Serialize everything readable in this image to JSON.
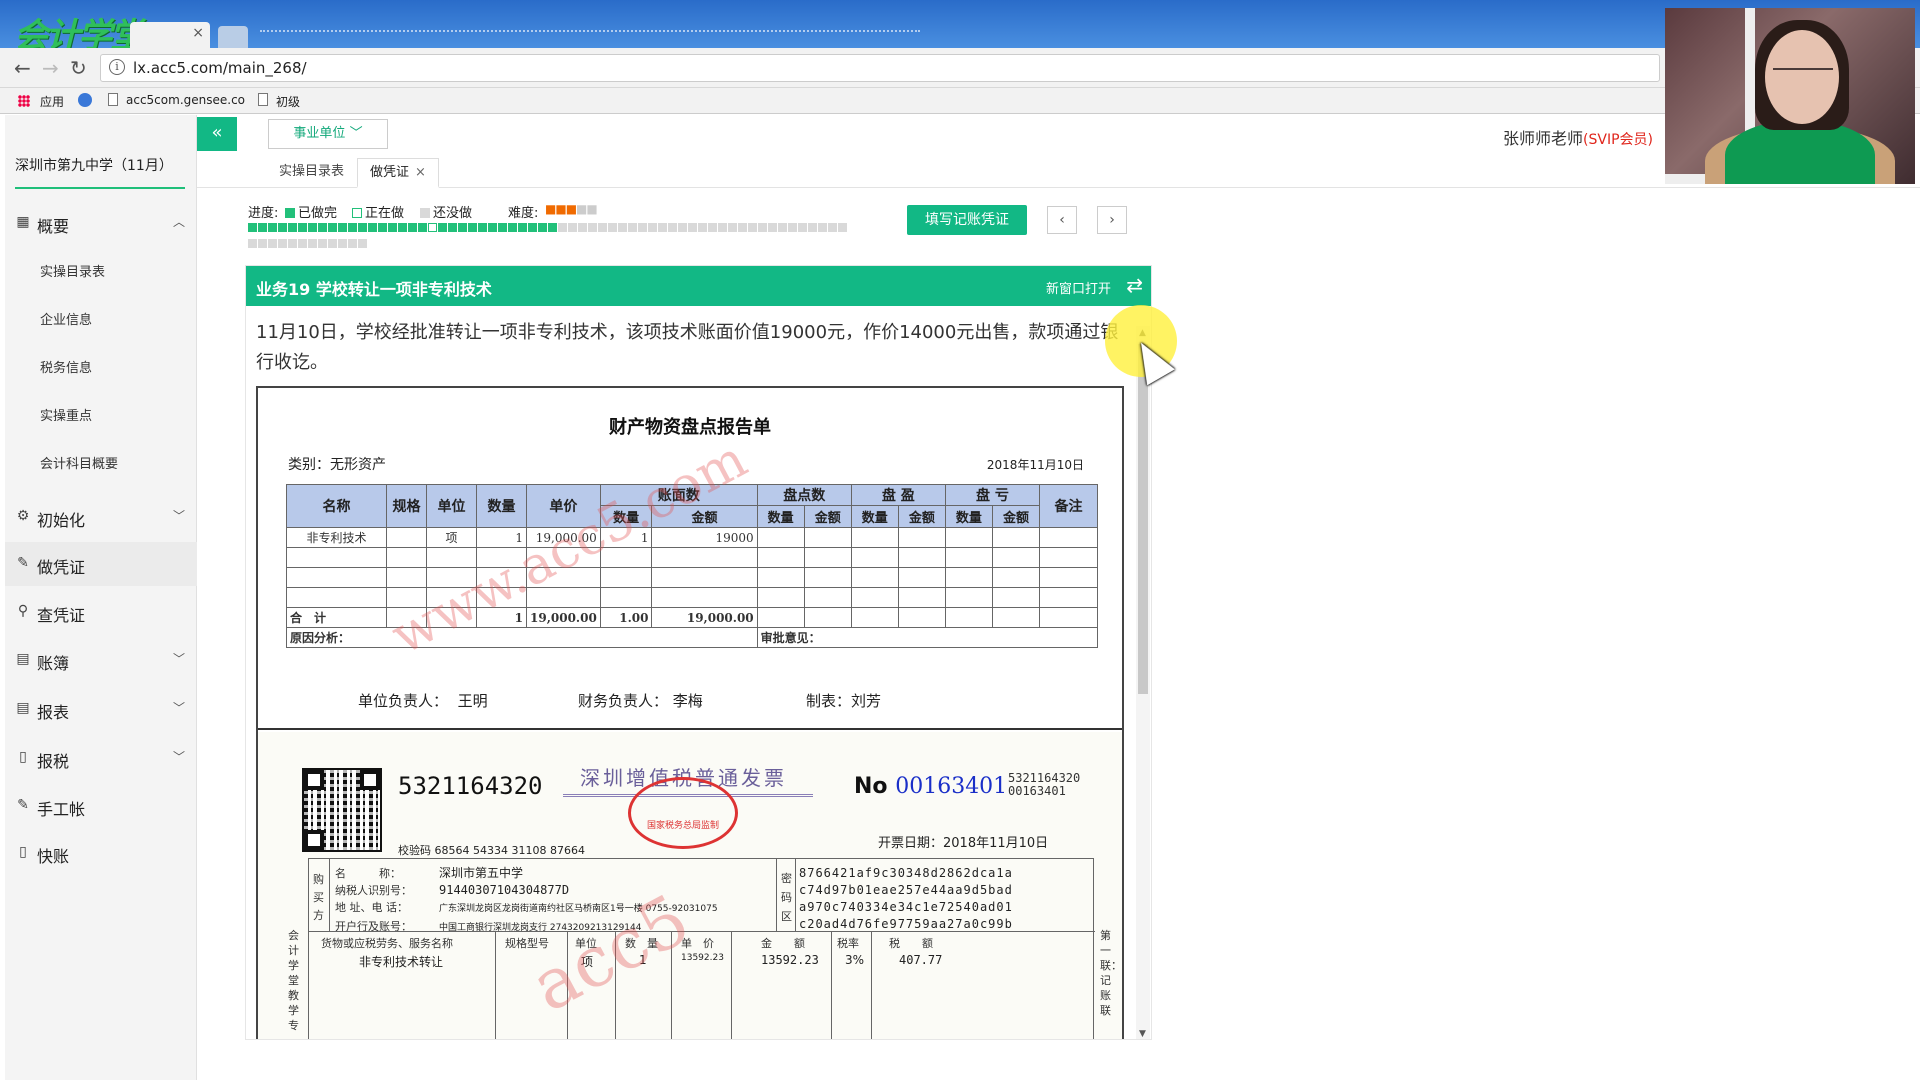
{
  "browser": {
    "logo": "会计学堂",
    "tab_close": "×",
    "url": "lx.acc5.com/main_268/",
    "bookmarks": [
      "应用",
      "acc5com.gensee.co",
      "初级"
    ]
  },
  "app": {
    "school": "深圳市第九中学（11月）",
    "unit_select": "事业单位",
    "teacher_name": "张师师老师",
    "teacher_badge": "(SVIP会员)",
    "collapse_icon": "«"
  },
  "sidebar": {
    "sections": [
      {
        "label": "概要",
        "icon": "overview-icon",
        "chevron": "^"
      },
      {
        "label": "初始化",
        "icon": "gear-icon",
        "chevron": "v"
      },
      {
        "label": "做凭证",
        "icon": "pen-icon"
      },
      {
        "label": "查凭证",
        "icon": "search-icon"
      },
      {
        "label": "账簿",
        "icon": "book-icon",
        "chevron": "v"
      },
      {
        "label": "报表",
        "icon": "report-icon",
        "chevron": "v"
      },
      {
        "label": "报税",
        "icon": "doc-icon",
        "chevron": "v"
      },
      {
        "label": "手工帐",
        "icon": "pen-icon"
      },
      {
        "label": "快账",
        "icon": "doc-icon"
      }
    ],
    "overview_items": [
      "实操目录表",
      "企业信息",
      "税务信息",
      "实操重点",
      "会计科目概要"
    ]
  },
  "page_tabs": [
    {
      "label": "实操目录表"
    },
    {
      "label": "做凭证",
      "close": "×"
    }
  ],
  "progress": {
    "label": "进度:",
    "done_label": "已做完",
    "doing_label": "正在做",
    "todo_label": "还没做",
    "difficulty_label": "难度:",
    "difficulty_rating": 3,
    "difficulty_max": 5,
    "total_tasks": 72,
    "done_tasks": 31,
    "current_task": 19
  },
  "actions": {
    "fill_voucher": "填写记账凭证",
    "prev": "‹",
    "next": "›"
  },
  "task": {
    "title": "业务19 学校转让一项非专利技术",
    "new_window": "新窗口打开",
    "swap_icon": "⇄",
    "description": "11月10日，学校经批准转让一项非专利技术，该项技术账面价值19000元，作价14000元出售，款项通过银行收讫。"
  },
  "report": {
    "title": "财产物资盘点报告单",
    "category": "类别：无形资产",
    "date": "2018年11月10日",
    "headers": {
      "name": "名称",
      "spec": "规格",
      "unit": "单位",
      "qty": "数量",
      "price": "单价",
      "book": "账面数",
      "count": "盘点数",
      "surplus": "盘 盈",
      "loss": "盘 亏",
      "note": "备注",
      "sub_qty": "数量",
      "sub_amt": "金额"
    },
    "row": {
      "name": "非专利技术",
      "unit": "项",
      "qty": "1",
      "price": "19,000.00",
      "book_qty": "1",
      "book_amt": "19000"
    },
    "total": {
      "label": "合　计",
      "qty": "1",
      "price": "19,000.00",
      "book_qty": "1.00",
      "book_amt": "19,000.00"
    },
    "reason_label": "原因分析：",
    "approval_label": "审批意见：",
    "head_label": "单位负责人：",
    "head_name": "王明",
    "finance_label": "财务负责人：",
    "finance_name": "李梅",
    "maker_label": "制表：",
    "maker_name": "刘芳",
    "watermark": "www.acc5.com"
  },
  "invoice": {
    "code": "5321164320",
    "title": "深圳增值税普通发票",
    "stamp_text": "国家税务总局监制",
    "no_label": "No",
    "number": "00163401",
    "code_small": "5321164320",
    "number_small": "00163401",
    "date": "开票日期：2018年11月10日",
    "check_code": "校验码 68564 54334 31108 87664",
    "buyer_side": "购买方",
    "buyer_name_label": "名　　　称：",
    "buyer_name": "深圳市第五中学",
    "buyer_tax_label": "纳税人识别号：",
    "buyer_tax": "91440307104304877D",
    "buyer_addr_label": "地 址、电 话：",
    "buyer_addr": "广东深圳龙岗区龙岗街道南约社区马桥南区1号一楼 0755-92031075",
    "buyer_bank_label": "开户行及账号：",
    "buyer_bank": "中国工商银行深圳龙岗支行 2743209213129144",
    "cipher_side": "密码区",
    "cipher": [
      "8766421af9c30348d2862dca1a",
      "c74d97b01eae257e44aa9d5bad",
      "a970c740334e34c1e72540ad01",
      "c20ad4d76fe97759aa27a0c99b"
    ],
    "col_goods": "货物或应税劳务、服务名称",
    "col_spec": "规格型号",
    "col_unit": "单位",
    "col_qty": "数　量",
    "col_price": "单　价",
    "col_amount": "金　　额",
    "col_rate": "税率",
    "col_tax": "税　　额",
    "item_name": "非专利技术转让",
    "item_unit": "项",
    "item_qty": "1",
    "item_price": "13592.23",
    "item_amount": "13592.23",
    "item_rate": "3%",
    "item_tax": "407.77",
    "left_vertical": "会计学堂教学专",
    "right_vertical": "第一联：记账联"
  },
  "colors": {
    "accent": "#12b885",
    "svip": "#e0261c",
    "table_header": "#b8c9ea"
  }
}
